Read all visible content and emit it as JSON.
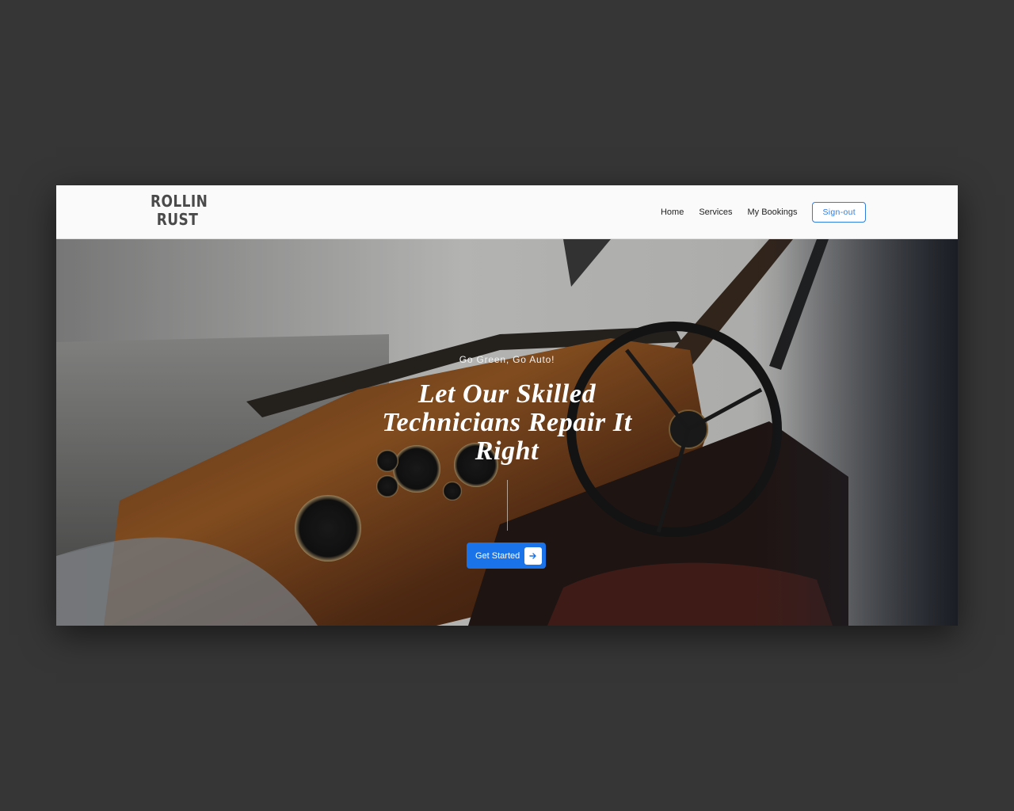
{
  "brand": {
    "logo_line1": "ROLLIN",
    "logo_line2": "RUST"
  },
  "nav": {
    "items": [
      {
        "label": "Home"
      },
      {
        "label": "Services"
      },
      {
        "label": "My Bookings"
      }
    ],
    "signout_label": "Sign-out"
  },
  "hero": {
    "eyebrow": "Go Green, Go Auto!",
    "headline": "Let Our Skilled Technicians Repair It Right",
    "cta_label": "Get Started",
    "cta_icon": "arrow-right-icon",
    "background_image": "classic car interior with wooden dashboard and steering wheel"
  },
  "colors": {
    "page_bg": "#363636",
    "accent": "#1a73e8",
    "signout_border": "#2f7de1",
    "navbar_bg": "#fafafa"
  }
}
